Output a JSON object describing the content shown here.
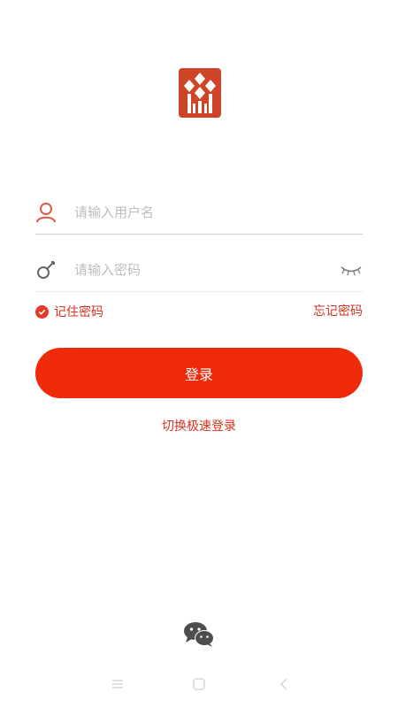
{
  "login": {
    "username_placeholder": "请输入用户名",
    "username_value": "",
    "password_placeholder": "请输入密码",
    "password_value": "",
    "remember_label": "记住密码",
    "remember_checked": true,
    "forgot_label": "忘记密码",
    "submit_label": "登录",
    "switch_label": "切换极速登录"
  },
  "colors": {
    "accent": "#ee2a0a",
    "link": "#d9311e",
    "logo": "#cf4327"
  },
  "icons": {
    "logo": "bank-logo-icon",
    "user": "user-icon",
    "key": "key-icon",
    "eye": "eye-closed-icon",
    "check": "check-circle-icon",
    "wechat": "wechat-icon",
    "nav_menu": "menu-icon",
    "nav_home": "home-icon",
    "nav_back": "back-icon"
  }
}
